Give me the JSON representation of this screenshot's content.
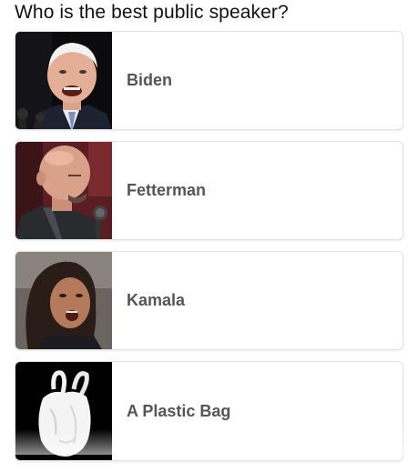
{
  "poll": {
    "question": "Who is the best public speaker?",
    "options": [
      {
        "label": "Biden",
        "image": "photo-man-white-hair-speaking-at-microphones"
      },
      {
        "label": "Fetterman",
        "image": "photo-bald-man-speaking-into-microphone"
      },
      {
        "label": "Kamala",
        "image": "photo-woman-dark-hair-speaking"
      },
      {
        "label": "A Plastic Bag",
        "image": "photo-white-plastic-bag-on-black"
      }
    ]
  }
}
